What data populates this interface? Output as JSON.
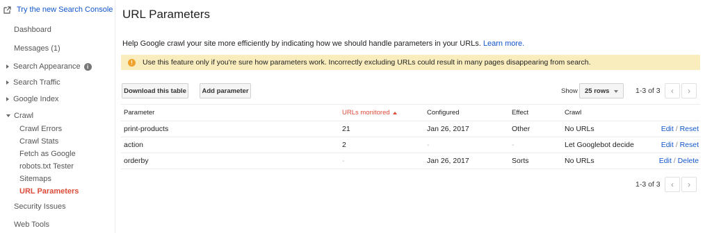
{
  "sidebar": {
    "search_console_link": "Try the new Search Console",
    "items": [
      {
        "label": "Dashboard"
      },
      {
        "label": "Messages (1)"
      },
      {
        "label": "Search Appearance"
      },
      {
        "label": "Search Traffic"
      },
      {
        "label": "Google Index"
      },
      {
        "label": "Crawl"
      }
    ],
    "crawl_subitems": [
      {
        "label": "Crawl Errors"
      },
      {
        "label": "Crawl Stats"
      },
      {
        "label": "Fetch as Google"
      },
      {
        "label": "robots.txt Tester"
      },
      {
        "label": "Sitemaps"
      },
      {
        "label": "URL Parameters"
      }
    ],
    "bottom_items": [
      {
        "label": "Security Issues"
      },
      {
        "label": "Web Tools"
      }
    ],
    "info_icon": "i"
  },
  "main": {
    "title": "URL Parameters",
    "help_text": "Help Google crawl your site more efficiently by indicating how we should handle parameters in your URLs.",
    "learn_more": "Learn more.",
    "warning_text": "Use this feature only if you're sure how parameters work. Incorrectly excluding URLs could result in many pages disappearing from search.",
    "warning_icon": "!",
    "download_button": "Download this table",
    "add_button": "Add parameter",
    "show_label": "Show",
    "rows_select": "25 rows",
    "pager_top": "1-3 of 3",
    "pager_bottom": "1-3 of 3",
    "prev_glyph": "‹",
    "next_glyph": "›"
  },
  "table": {
    "headers": {
      "parameter": "Parameter",
      "urls": "URLs monitored",
      "configured": "Configured",
      "effect": "Effect",
      "crawl": "Crawl"
    },
    "rows": [
      {
        "parameter": "print-products",
        "urls": "21",
        "configured": "Jan 26, 2017",
        "effect": "Other",
        "crawl": "No URLs",
        "edit": "Edit",
        "sep": "/",
        "action2": "Reset"
      },
      {
        "parameter": "action",
        "urls": "2",
        "configured": "-",
        "effect": "-",
        "crawl": "Let Googlebot decide",
        "edit": "Edit",
        "sep": "/",
        "action2": "Reset"
      },
      {
        "parameter": "orderby",
        "urls": "-",
        "configured": "Jan 26, 2017",
        "effect": "Sorts",
        "crawl": "No URLs",
        "edit": "Edit",
        "sep": "/",
        "action2": "Delete"
      }
    ]
  },
  "colors": {
    "link": "#1155cc",
    "active": "#dd4b39",
    "warning_bg": "#f9edbe",
    "warning_icon": "#f0a22d"
  }
}
